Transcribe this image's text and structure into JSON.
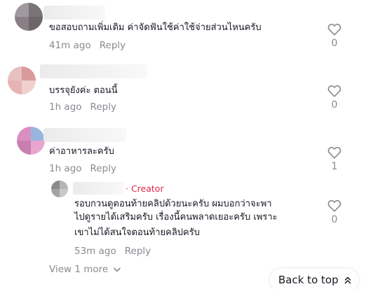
{
  "comments": [
    {
      "text": "ขอสอบถามเพิ่มเติม ค่าจัดฟันใช้ค่าใช้จ่ายส่วนไหนครับ",
      "time": "41m ago",
      "reply_label": "Reply",
      "likes": "0"
    },
    {
      "text": "บรรจุยังค่ะ ตอนนี้",
      "time": "1h ago",
      "reply_label": "Reply",
      "likes": "0"
    },
    {
      "text": "ค่าอาหารละครับ",
      "time": "1h ago",
      "reply_label": "Reply",
      "likes": "1"
    }
  ],
  "creator_reply": {
    "tag": "· Creator",
    "lines": [
      "รอบกวนดูตอนท้ายคลิปด้วยนะครับ ผมบอกว่าจะพา",
      "ไปดูรายได้เสริมครับ เรื่องนี้คนพลาดเยอะครับ เพราะ",
      "เขาไม่ได้สนใจตอนท้ายคลิปครับ"
    ],
    "time": "53m ago",
    "reply_label": "Reply",
    "likes": "0"
  },
  "view_more_label": "View 1 more",
  "back_to_top_label": "Back to top",
  "icons": {
    "like": "heart-outline-icon",
    "chevron": "chevron-down-icon",
    "back_top": "double-chevron-up-icon"
  },
  "colors": {
    "creator": "#e3284b",
    "meta": "#8a8b91"
  }
}
